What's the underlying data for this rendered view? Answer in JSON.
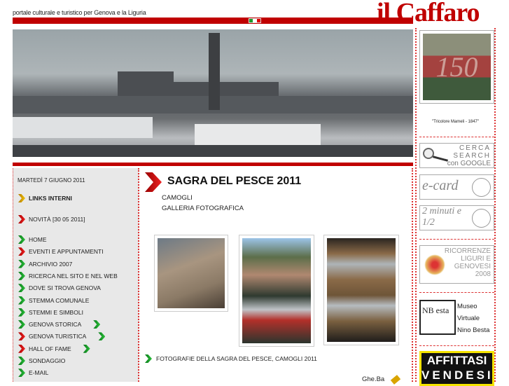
{
  "header": {
    "tagline": "portale culturale e turistico per Genova e la Liguria",
    "logo": "il Caffaro",
    "colors": {
      "brand": "#c00000"
    }
  },
  "sidebar": {
    "date": "MARTEDÌ 7 GIUGNO 2011",
    "links_title": "LINKS INTERNI",
    "novita": "NOVITÀ [30 05 2011]",
    "items": [
      {
        "label": "HOME",
        "arrow": "g",
        "extra": false
      },
      {
        "label": "EVENTI E APPUNTAMENTI",
        "arrow": "r",
        "extra": false
      },
      {
        "label": "ARCHIVIO 2007",
        "arrow": "g",
        "extra": false
      },
      {
        "label": "RICERCA NEL SITO E NEL WEB",
        "arrow": "g",
        "extra": false
      },
      {
        "label": "DOVE SI TROVA GENOVA",
        "arrow": "g",
        "extra": false
      },
      {
        "label": "STEMMA COMUNALE",
        "arrow": "g",
        "extra": false
      },
      {
        "label": "STEMMI E SIMBOLI",
        "arrow": "g",
        "extra": false
      },
      {
        "label": "GENOVA STORICA",
        "arrow": "g",
        "extra": true
      },
      {
        "label": "GENOVA TURISTICA",
        "arrow": "r",
        "extra": true
      },
      {
        "label": "HALL OF FAME",
        "arrow": "r",
        "extra": true
      },
      {
        "label": "SONDAGGIO",
        "arrow": "g",
        "extra": false
      },
      {
        "label": "E-MAIL",
        "arrow": "g",
        "extra": false
      }
    ]
  },
  "main": {
    "title": "SAGRA DEL PESCE 2011",
    "subtitle1": "CAMOGLI",
    "subtitle2": "GALLERIA FOTOGRAFICA",
    "caption": "FOTOGRAFIE DELLA SAGRA DEL PESCE, CAMOGLI 2011",
    "signature": "Ghe.Ba"
  },
  "right": {
    "image_150": "150",
    "image_caption": "\"Tricolore Mameli - 1847\"",
    "search": [
      "CERCA",
      "SEARCH",
      "con GOOGLE"
    ],
    "ecard": "e-card",
    "minuti": "2 minuti e 1/2",
    "ricorrenze": [
      "RICORRENZE",
      "LIGURI E",
      "GENOVESI",
      "2008"
    ],
    "museo": [
      "Museo",
      "Virtuale",
      "Nino Besta"
    ],
    "besta_logo": "NB esta",
    "affittasi": "AFFITTASI",
    "vendesi": "VENDESI"
  }
}
